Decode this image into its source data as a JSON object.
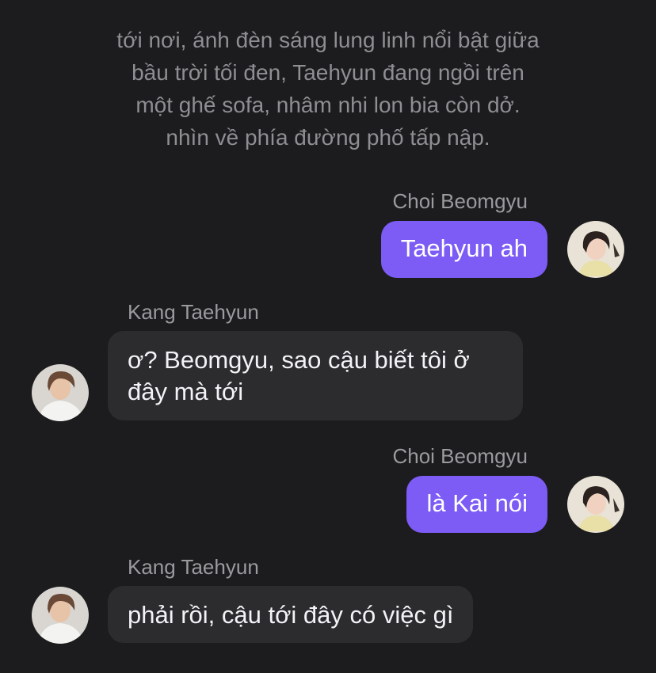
{
  "narration": {
    "lines": [
      "tới nơi, ánh đèn sáng lung linh nổi bật giữa",
      "bầu trời tối đen, Taehyun đang ngồi trên",
      "một ghế sofa, nhâm nhi lon bia còn dở.",
      "nhìn về phía đường phố tấp nập."
    ]
  },
  "messages": [
    {
      "sender": "Choi Beomgyu",
      "text": "Taehyun ah",
      "direction": "outgoing",
      "avatar": "beomgyu-avatar"
    },
    {
      "sender": "Kang Taehyun",
      "text": "ơ? Beomgyu, sao cậu biết tôi ở đây mà tới",
      "direction": "incoming",
      "avatar": "taehyun-avatar"
    },
    {
      "sender": "Choi Beomgyu",
      "text": "là Kai nói",
      "direction": "outgoing",
      "avatar": "beomgyu-avatar"
    },
    {
      "sender": "Kang Taehyun",
      "text": "phải rồi, cậu tới đây có việc gì",
      "direction": "incoming",
      "avatar": "taehyun-avatar"
    }
  ],
  "colors": {
    "background": "#1c1c1e",
    "outgoing_bubble": "#7c5cf5",
    "incoming_bubble": "#2c2c2e",
    "narration_text": "#8e8e93"
  }
}
